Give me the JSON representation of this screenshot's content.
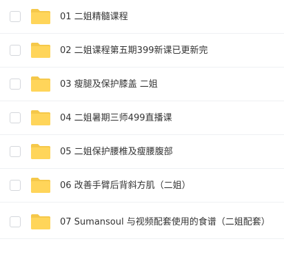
{
  "folder_color": "#ffd55a",
  "folder_tab_color": "#f5c84a",
  "items": [
    {
      "name": "01 二姐精髓课程",
      "icon": "folder-icon"
    },
    {
      "name": "02 二姐课程第五期399新课已更新完",
      "icon": "folder-icon"
    },
    {
      "name": "03 瘦腿及保护膝盖 二姐",
      "icon": "folder-icon"
    },
    {
      "name": "04 二姐暑期三师499直播课",
      "icon": "folder-icon"
    },
    {
      "name": "05 二姐保护腰椎及瘦腰腹部",
      "icon": "folder-icon"
    },
    {
      "name": "06 改善手臂后背斜方肌（二姐）",
      "icon": "folder-icon"
    },
    {
      "name": "07 Sumansoul 与视频配套使用的食谱（二姐配套）",
      "icon": "folder-icon"
    }
  ]
}
